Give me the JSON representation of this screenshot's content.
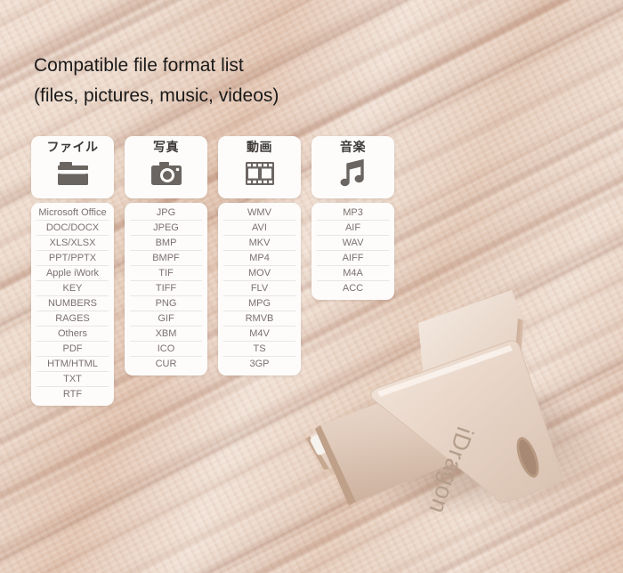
{
  "heading": {
    "line1": "Compatible file format list",
    "line2": "(files, pictures, music, videos)"
  },
  "colors": {
    "background": "#e9d3c5",
    "card": "#fdfcfb",
    "heading_text": "#1a1a1a",
    "category_text": "#3d3a38",
    "format_text": "#7b7170",
    "icon": "#6b6561",
    "row_divider": "#e9e5e3",
    "usb_metal": "#e7d8cc"
  },
  "columns": [
    {
      "id": "files",
      "label": "ファイル",
      "icon": "folder-icon",
      "formats": [
        "Microsoft Office",
        "DOC/DOCX",
        "XLS/XLSX",
        "PPT/PPTX",
        "Apple iWork",
        "KEY",
        "NUMBERS",
        "RAGES",
        "Others",
        "PDF",
        "HTM/HTML",
        "TXT",
        "RTF"
      ]
    },
    {
      "id": "pictures",
      "label": "写真",
      "icon": "camera-icon",
      "formats": [
        "JPG",
        "JPEG",
        "BMP",
        "BMPF",
        "TIF",
        "TIFF",
        "PNG",
        "GIF",
        "XBM",
        "ICO",
        "CUR"
      ]
    },
    {
      "id": "videos",
      "label": "動画",
      "icon": "film-strip-icon",
      "formats": [
        "WMV",
        "AVI",
        "MKV",
        "MP4",
        "MOV",
        "FLV",
        "MPG",
        "RMVB",
        "M4V",
        "TS",
        "3GP"
      ]
    },
    {
      "id": "music",
      "label": "音楽",
      "icon": "music-note-icon",
      "formats": [
        "MP3",
        "AIF",
        "WAV",
        "AIFF",
        "M4A",
        "ACC"
      ]
    }
  ],
  "product": {
    "name": "usb-flash-drive",
    "brand_text": "iDragon",
    "connector": "lightning-connector"
  }
}
